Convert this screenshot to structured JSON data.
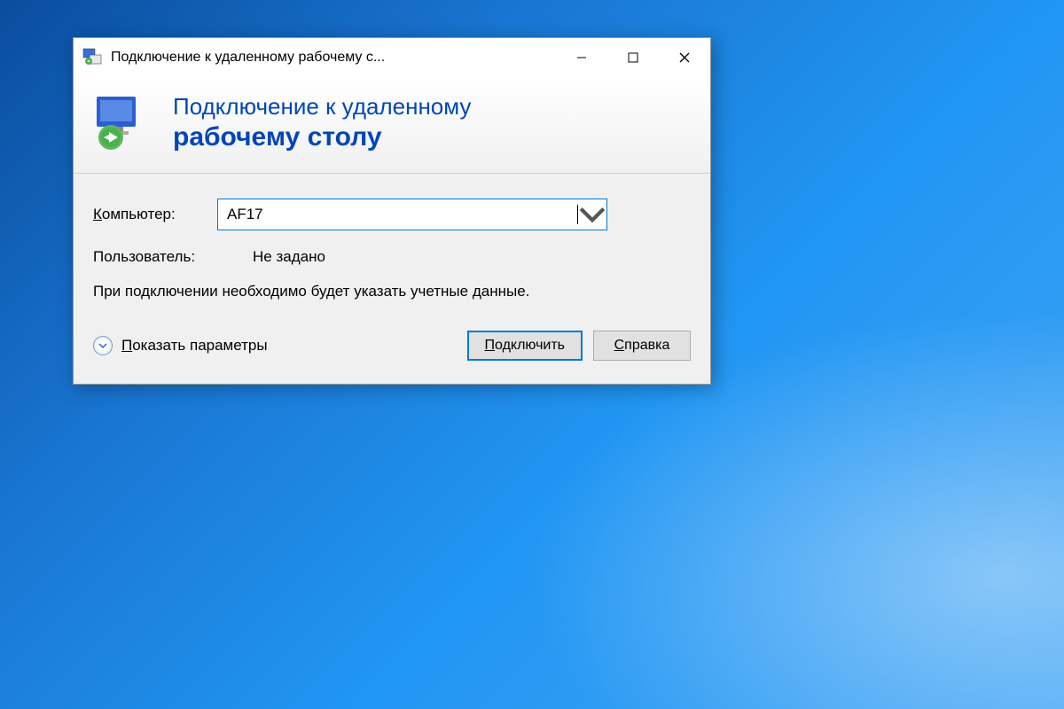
{
  "window": {
    "title": "Подключение к удаленному рабочему с..."
  },
  "header": {
    "line1": "Подключение к удаленному",
    "line2": "рабочему столу"
  },
  "form": {
    "computer_label_prefix": "К",
    "computer_label_rest": "омпьютер:",
    "computer_value": "AF17",
    "user_label": "Пользователь:",
    "user_value": "Не задано",
    "info_text": "При подключении необходимо будет указать учетные данные."
  },
  "footer": {
    "show_params_prefix": "П",
    "show_params_rest": "оказать параметры",
    "connect_prefix": "П",
    "connect_rest": "одключить",
    "help_prefix": "С",
    "help_rest": "правка"
  }
}
